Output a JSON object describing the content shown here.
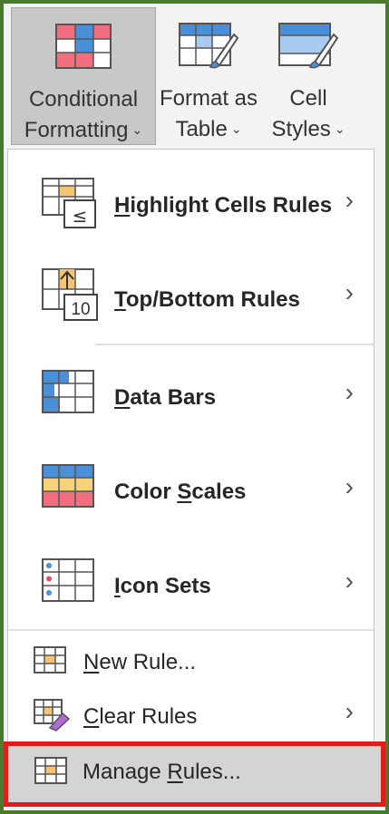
{
  "ribbon": {
    "conditional_formatting": {
      "line1": "Conditional",
      "line2": "Formatting"
    },
    "format_as_table": {
      "line1": "Format as",
      "line2": "Table"
    },
    "cell_styles": {
      "line1": "Cell",
      "line2": "Styles"
    },
    "chevron": "⌄"
  },
  "menu": {
    "items": [
      {
        "label_u": "H",
        "label_rest": "ighlight Cells Rules",
        "icon": "highlight-cells-icon",
        "arrow": "›"
      },
      {
        "label_u": "T",
        "label_rest": "op/Bottom Rules",
        "icon": "top-bottom-icon",
        "arrow": "›"
      },
      {
        "label_u": "D",
        "label_rest": "ata Bars",
        "icon": "data-bars-icon",
        "arrow": "›"
      },
      {
        "label_pre": "Color ",
        "label_u": "S",
        "label_rest": "cales",
        "icon": "color-scales-icon",
        "arrow": "›"
      },
      {
        "label_u": "I",
        "label_rest": "con Sets",
        "icon": "icon-sets-icon",
        "arrow": "›"
      }
    ],
    "small_items": [
      {
        "label_u": "N",
        "label_rest": "ew Rule...",
        "icon": "new-rule-icon"
      },
      {
        "label_u": "C",
        "label_rest": "lear Rules",
        "icon": "clear-rules-icon",
        "arrow": "›"
      },
      {
        "label_pre": "Manage ",
        "label_u": "R",
        "label_rest": "ules...",
        "icon": "manage-rules-icon"
      }
    ],
    "top_bottom_number": "10",
    "highlight_symbol": "≤"
  },
  "colors": {
    "frame": "#4a7a2c",
    "highlight_border": "#e21b1b"
  }
}
